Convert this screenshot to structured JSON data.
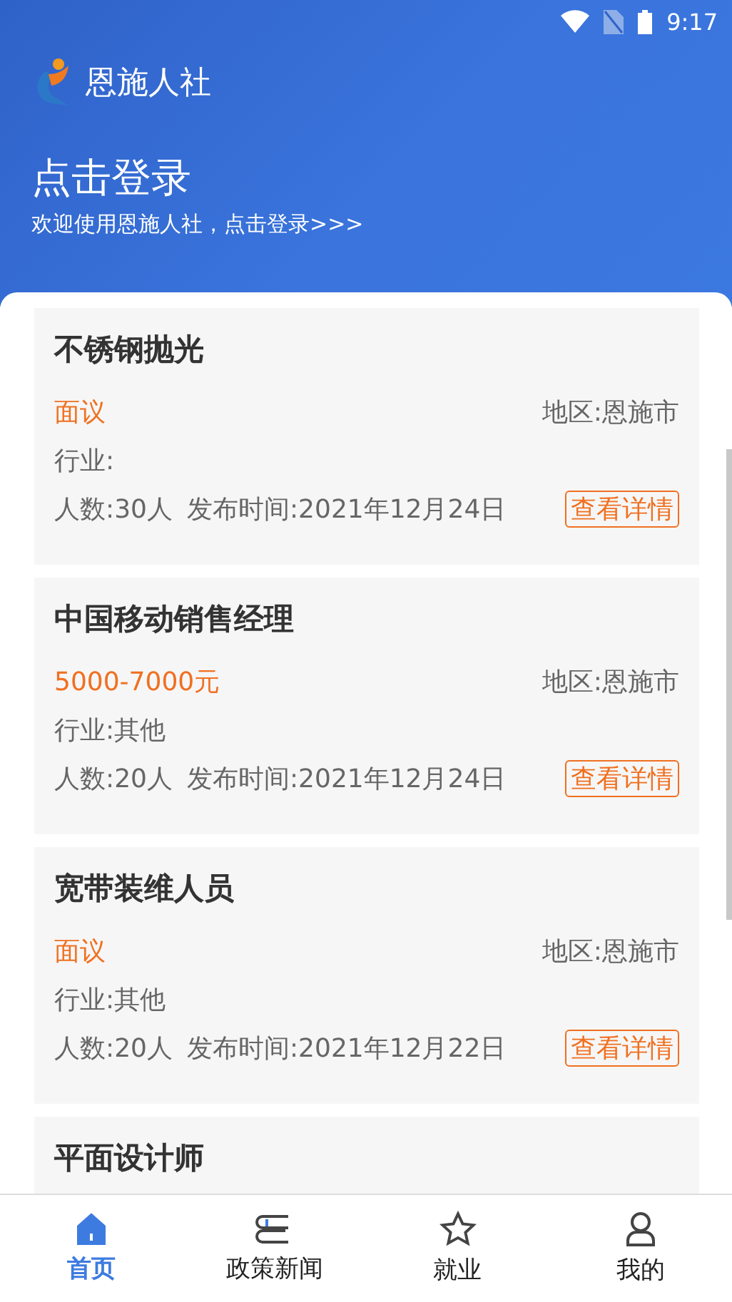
{
  "status_bar": {
    "time": "9:17"
  },
  "header": {
    "app_name": "恩施人社",
    "login_title": "点击登录",
    "login_subtitle": "欢迎使用恩施人社，点击登录>>>"
  },
  "jobs": [
    {
      "title": "不锈钢抛光",
      "salary": "面议",
      "region": "地区:恩施市",
      "industry": "行业:",
      "headcount": "人数:30人",
      "published": "发布时间:2021年12月24日",
      "details_link": "查看详情"
    },
    {
      "title": "中国移动销售经理",
      "salary": "5000-7000元",
      "region": "地区:恩施市",
      "industry": "行业:其他",
      "headcount": "人数:20人",
      "published": "发布时间:2021年12月24日",
      "details_link": "查看详情"
    },
    {
      "title": "宽带装维人员",
      "salary": "面议",
      "region": "地区:恩施市",
      "industry": "行业:其他",
      "headcount": "人数:20人",
      "published": "发布时间:2021年12月22日",
      "details_link": "查看详情"
    },
    {
      "title": "平面设计师"
    }
  ],
  "bottom_nav": [
    {
      "kind": "home",
      "label": "首页",
      "selected": true
    },
    {
      "kind": "news",
      "label": "政策新闻",
      "selected": false
    },
    {
      "kind": "jobs",
      "label": "就业",
      "selected": false
    },
    {
      "kind": "profile",
      "label": "我的",
      "selected": false
    }
  ]
}
